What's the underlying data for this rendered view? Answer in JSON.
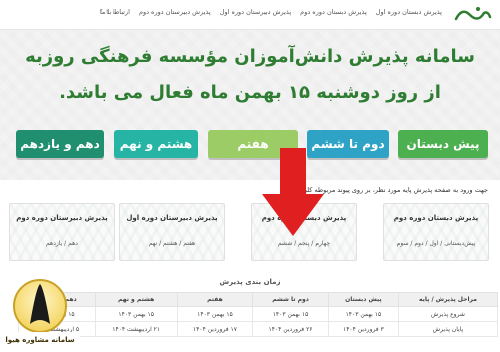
{
  "nav": {
    "items": [
      "پذیرش دبستان دوره اول",
      "پذیرش دبستان دوره دوم",
      "پذیرش دبیرستان دوره اول",
      "پذیرش دبیرستان دوره دوم"
    ],
    "contact": "ارتباط با ما",
    "social": [
      "f",
      "t",
      "i"
    ]
  },
  "hero": {
    "line1": "سامانه پذیرش دانش‌آموزان مؤسسه فرهنگی روزبه",
    "line2": "از روز دوشنبه ۱۵ بهمن ماه فعال می باشد.",
    "buttons": [
      {
        "label": "پیش دبستان",
        "color": "#4caf50"
      },
      {
        "label": "دوم تا ششم",
        "color": "#2ea3c6"
      },
      {
        "label": "هفتم",
        "color": "#9ccc65"
      },
      {
        "label": "هشتم و نهم",
        "color": "#26b5a4"
      },
      {
        "label": "دهم و یازدهم",
        "color": "#1f8f6f"
      }
    ]
  },
  "intro": "جهت ورود به صفحه پذیرش پایه مورد نظر، بر روی پیوند مربوطه کلیک نمایید.",
  "cards": [
    {
      "title": "پذیرش دبستان دوره دوم",
      "sub": "پیش‌دبستانی / اول / دوم / سوم"
    },
    {
      "title": "پذیرش دبستان دوره دوم",
      "sub": "چهارم / پنجم / ششم"
    },
    {
      "title": "پذیرش دبیرستان دوره اول",
      "sub": "هفتم / هشتم / نهم"
    },
    {
      "title": "پذیرش دبیرستان دوره دوم",
      "sub": "دهم / یازدهم"
    }
  ],
  "schedule": {
    "title": "زمان بندی پذیرش",
    "headers": [
      "مراحل پذیرش / پایه",
      "پیش دبستان",
      "دوم تا ششم",
      "هفتم",
      "هشتم و نهم",
      "دهم و یازدهم"
    ],
    "rows": [
      [
        "شروع پذیرش",
        "۱۵ بهمن ۱۴۰۳",
        "۱۵ بهمن ۱۴۰۳",
        "۱۵ بهمن ۱۴۰۳",
        "۱۵ بهمن ۱۴۰۳",
        "۱۵ بهمن ۱۴۰۳"
      ],
      [
        "پایان پذیرش",
        "۳ فروردین ۱۴۰۴",
        "۲۶ فروردین ۱۴۰۴",
        "۱۷ فروردین ۱۴۰۴",
        "۲۱ اردیبهشت ۱۴۰۴",
        "۵ اردیبهشت ۱۴۰۴"
      ]
    ]
  },
  "badge": {
    "text": "سامانه مشاوره هیوا"
  },
  "colors": {
    "headline": "#2e7d32",
    "arrow": "#e02020"
  }
}
